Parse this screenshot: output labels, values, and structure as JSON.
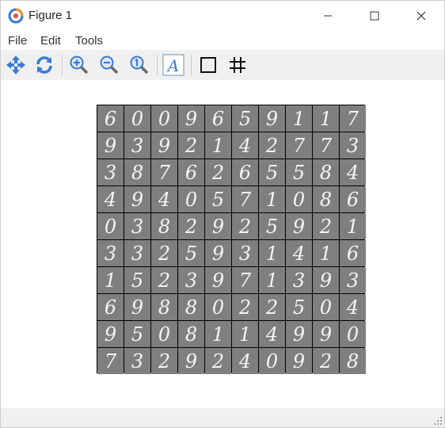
{
  "window": {
    "title": "Figure 1"
  },
  "menu": {
    "items": [
      "File",
      "Edit",
      "Tools"
    ]
  },
  "toolbar": {
    "tools": [
      {
        "name": "pan-tool-button",
        "icon": "move-arrows-icon"
      },
      {
        "name": "refresh-button",
        "icon": "refresh-icon"
      },
      {
        "name": "zoom-in-button",
        "icon": "zoom-in-icon"
      },
      {
        "name": "zoom-out-button",
        "icon": "zoom-out-icon"
      },
      {
        "name": "zoom-reset-button",
        "icon": "zoom-one-icon"
      },
      {
        "name": "text-style-button",
        "icon": "font-a-icon"
      },
      {
        "name": "box-button",
        "icon": "square-icon"
      },
      {
        "name": "grid-button",
        "icon": "grid-hash-icon"
      }
    ]
  },
  "colors": {
    "cell_bg": "#7f7f7f",
    "grid_border": "#000000",
    "toolbar_bg": "#f0f0f0",
    "icon_blue": "#3a7bd5"
  },
  "digits": [
    [
      "6",
      "0",
      "0",
      "9",
      "6",
      "5",
      "9",
      "1",
      "1",
      "7"
    ],
    [
      "9",
      "3",
      "9",
      "2",
      "1",
      "4",
      "2",
      "7",
      "7",
      "3"
    ],
    [
      "3",
      "8",
      "7",
      "6",
      "2",
      "6",
      "5",
      "5",
      "8",
      "4"
    ],
    [
      "4",
      "9",
      "4",
      "0",
      "5",
      "7",
      "1",
      "0",
      "8",
      "6"
    ],
    [
      "0",
      "3",
      "8",
      "2",
      "9",
      "2",
      "5",
      "9",
      "2",
      "1"
    ],
    [
      "3",
      "3",
      "2",
      "5",
      "9",
      "3",
      "1",
      "4",
      "1",
      "6"
    ],
    [
      "1",
      "5",
      "2",
      "3",
      "9",
      "7",
      "1",
      "3",
      "9",
      "3"
    ],
    [
      "6",
      "9",
      "8",
      "8",
      "0",
      "2",
      "2",
      "5",
      "0",
      "4"
    ],
    [
      "9",
      "5",
      "0",
      "8",
      "1",
      "1",
      "4",
      "9",
      "9",
      "0"
    ],
    [
      "7",
      "3",
      "2",
      "9",
      "2",
      "4",
      "0",
      "9",
      "2",
      "8"
    ]
  ]
}
